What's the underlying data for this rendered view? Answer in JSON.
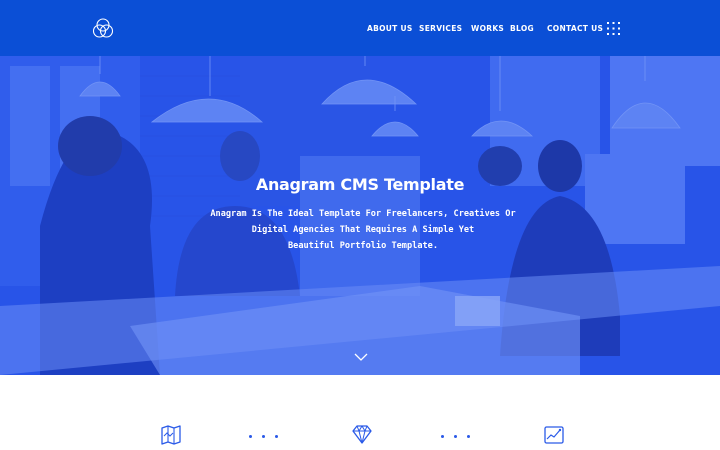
{
  "header": {
    "background": "#0b4fd6",
    "logo_icon": "interlocking-circles-logo",
    "nav": [
      {
        "label": "ABOUT US"
      },
      {
        "label": "SERVICES"
      },
      {
        "label": "WORKS"
      },
      {
        "label": "BLOG"
      },
      {
        "label": "CONTACT US"
      }
    ],
    "menu_icon": "grid-dots-icon"
  },
  "hero": {
    "title": "Anagram CMS Template",
    "subtitle_lines": [
      "Anagram Is The Ideal Template For Freelancers, Creatives Or",
      "Digital Agencies That Requires A Simple Yet",
      "Beautiful Portfolio Template."
    ],
    "overlay_color": "#2a56e6",
    "scroll_icon": "chevron-down-icon"
  },
  "features": {
    "icons": [
      "map-icon",
      "diamond-icon",
      "chart-icon"
    ],
    "accent": "#2a5ae8"
  }
}
